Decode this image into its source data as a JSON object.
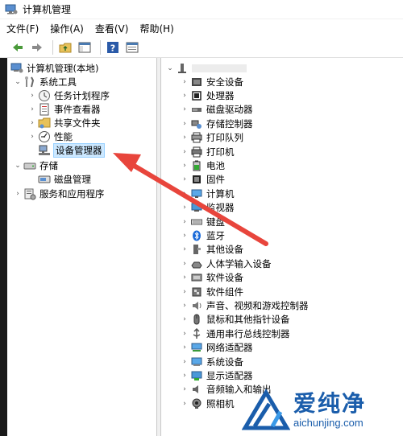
{
  "window": {
    "title": "计算机管理"
  },
  "menubar": {
    "items": [
      "文件(F)",
      "操作(A)",
      "查看(V)",
      "帮助(H)"
    ]
  },
  "left_tree": {
    "root": "计算机管理(本地)",
    "system_tools": "系统工具",
    "task_scheduler": "任务计划程序",
    "event_viewer": "事件查看器",
    "shared_folders": "共享文件夹",
    "performance": "性能",
    "device_manager": "设备管理器",
    "storage": "存储",
    "disk_management": "磁盘管理",
    "services_apps": "服务和应用程序"
  },
  "right_tree": {
    "categories": [
      "安全设备",
      "处理器",
      "磁盘驱动器",
      "存储控制器",
      "打印队列",
      "打印机",
      "电池",
      "固件",
      "计算机",
      "监视器",
      "键盘",
      "蓝牙",
      "其他设备",
      "人体学输入设备",
      "软件设备",
      "软件组件",
      "声音、视频和游戏控制器",
      "鼠标和其他指针设备",
      "通用串行总线控制器",
      "网络适配器",
      "系统设备",
      "显示适配器",
      "音频输入和输出",
      "照相机"
    ]
  },
  "watermark": {
    "cn": "爱纯净",
    "en": "aichunjing.com"
  },
  "colors": {
    "arrow": "#e8453c",
    "selection": "#cce8ff",
    "brand": "#1a5dab"
  }
}
